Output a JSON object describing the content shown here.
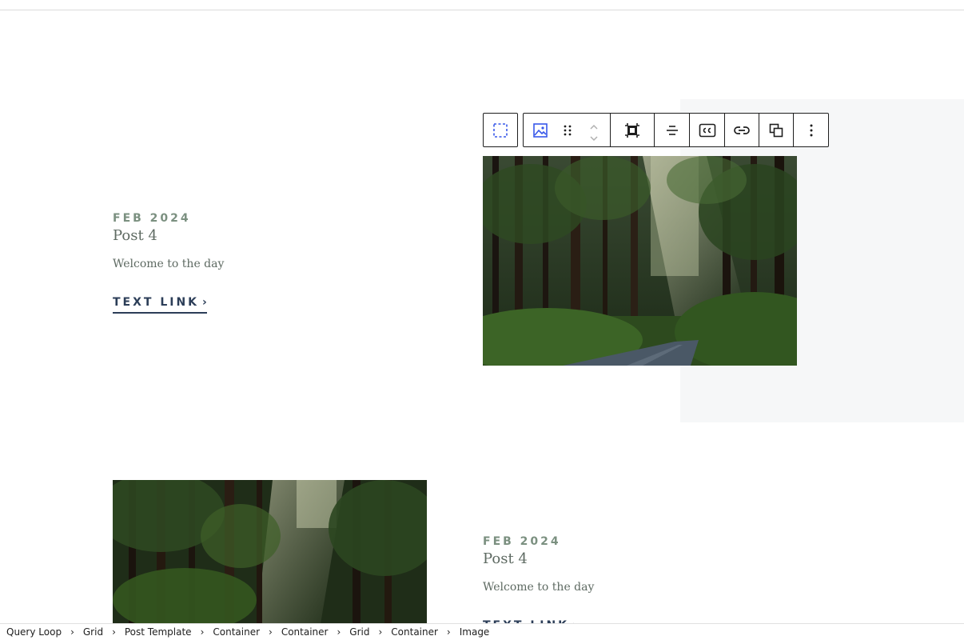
{
  "posts": [
    {
      "date": "FEB 2024",
      "title": "Post 4",
      "excerpt": "Welcome to the day",
      "link_label": "TEXT LINK",
      "link_chevron": "›"
    },
    {
      "date": "FEB 2024",
      "title": "Post 4",
      "excerpt": "Welcome to the day",
      "link_label": "TEXT LINK",
      "link_chevron": "›"
    }
  ],
  "toolbar": {
    "buttons": [
      {
        "name": "select-parent",
        "icon": "dashed-square-icon"
      },
      {
        "name": "block-type",
        "icon": "image-icon"
      },
      {
        "name": "drag-handle",
        "icon": "drag-handle-icon"
      },
      {
        "name": "move-up",
        "icon": "chevron-up-icon"
      },
      {
        "name": "move-down",
        "icon": "chevron-down-icon"
      },
      {
        "name": "crop",
        "icon": "crop-icon"
      },
      {
        "name": "align",
        "icon": "align-center-icon"
      },
      {
        "name": "caption",
        "icon": "caption-cc-icon"
      },
      {
        "name": "link",
        "icon": "link-icon"
      },
      {
        "name": "duplicate",
        "icon": "duplicate-icon"
      },
      {
        "name": "options",
        "icon": "more-vertical-icon"
      }
    ]
  },
  "breadcrumb": {
    "items": [
      "Query Loop",
      "Grid",
      "Post Template",
      "Container",
      "Container",
      "Grid",
      "Container",
      "Image"
    ],
    "separator": "›"
  },
  "colors": {
    "date": "#7b9080",
    "text": "#5e6a62",
    "link": "#2c3e58",
    "accent": "#3858e9",
    "panel": "#f6f7f8"
  }
}
